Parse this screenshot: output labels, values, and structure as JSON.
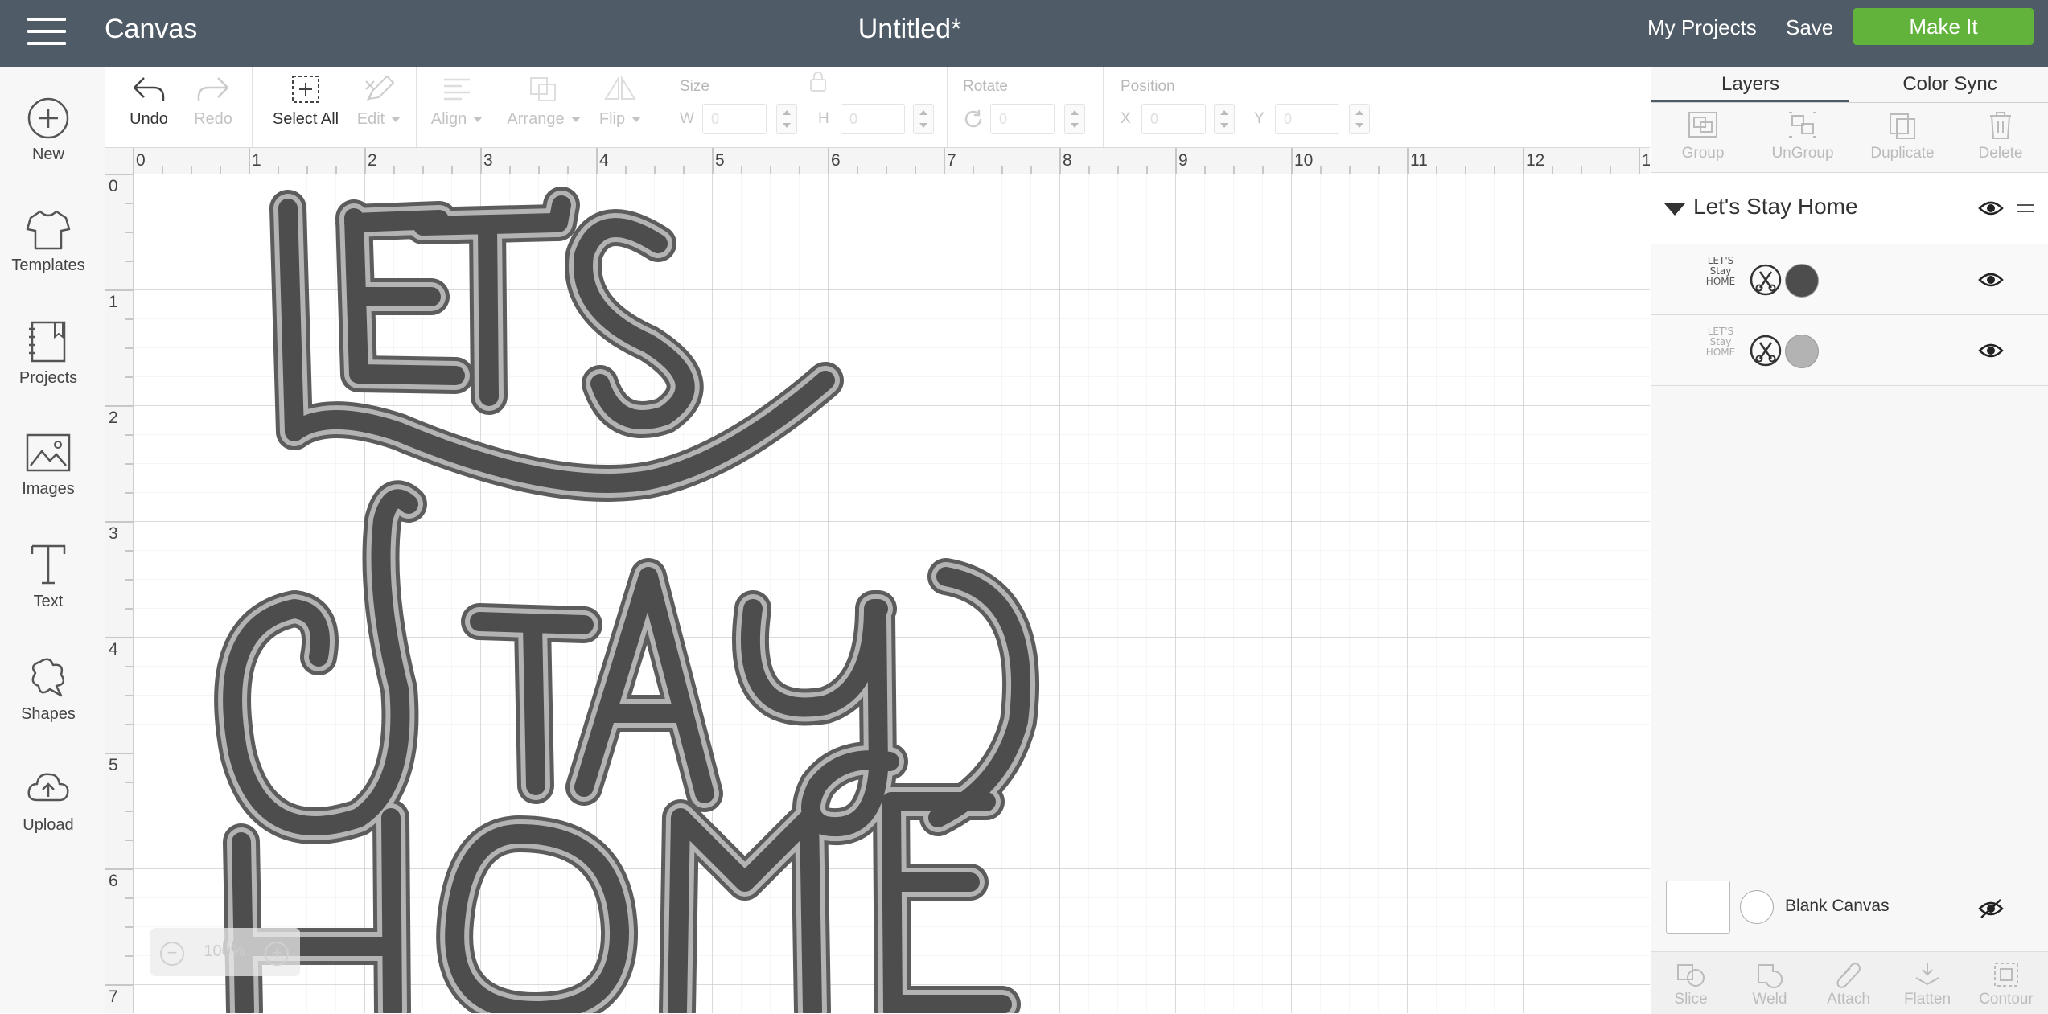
{
  "header": {
    "app_title": "Canvas",
    "doc_title": "Untitled*",
    "my_projects": "My Projects",
    "save": "Save",
    "make_it": "Make It",
    "menu_icon": "hamburger-menu-icon",
    "accent_color": "#61b33b",
    "bar_color": "#4f5b66"
  },
  "sidebar": {
    "items": [
      {
        "label": "New",
        "icon": "plus-circle-icon"
      },
      {
        "label": "Templates",
        "icon": "tshirt-icon"
      },
      {
        "label": "Projects",
        "icon": "notebook-icon"
      },
      {
        "label": "Images",
        "icon": "image-icon"
      },
      {
        "label": "Text",
        "icon": "text-t-icon"
      },
      {
        "label": "Shapes",
        "icon": "shapes-icon"
      },
      {
        "label": "Upload",
        "icon": "cloud-upload-icon"
      }
    ]
  },
  "toolbar": {
    "undo": "Undo",
    "redo": "Redo",
    "select_all": "Select All",
    "edit": "Edit",
    "align": "Align",
    "arrange": "Arrange",
    "flip": "Flip",
    "size_label": "Size",
    "w_label": "W",
    "h_label": "H",
    "w_value": "0",
    "h_value": "0",
    "rotate_label": "Rotate",
    "rotate_value": "0",
    "position_label": "Position",
    "x_label": "X",
    "y_label": "Y",
    "x_value": "0",
    "y_value": "0"
  },
  "canvas": {
    "ruler_top": [
      "0",
      "1",
      "2",
      "3",
      "4",
      "5",
      "6",
      "7",
      "8",
      "9",
      "10",
      "11",
      "12",
      "1"
    ],
    "ruler_left": [
      "0",
      "1",
      "2",
      "3",
      "4",
      "5",
      "6",
      "7"
    ],
    "zoom_level": "100%",
    "zoom_out": "−",
    "zoom_in": "+",
    "design": {
      "line1": "LET'S",
      "line2": "Stay",
      "line3": "HOME",
      "fill_color": "#4d4d4d",
      "outline_color": "#b3b3b3"
    }
  },
  "panel": {
    "tabs": [
      "Layers",
      "Color Sync"
    ],
    "actions": [
      "Group",
      "UnGroup",
      "Duplicate",
      "Delete"
    ],
    "group_name": "Let's Stay Home",
    "layers": [
      {
        "thumb_text": "LET'S Stay HOME",
        "op_icon": "scissors-cut-icon",
        "color": "#4d4d4d"
      },
      {
        "thumb_text": "LET'S Stay HOME",
        "op_icon": "scissors-cut-icon",
        "color": "#b3b3b3"
      }
    ],
    "blank_canvas": "Blank Canvas",
    "bottom_actions": [
      "Slice",
      "Weld",
      "Attach",
      "Flatten",
      "Contour"
    ]
  }
}
